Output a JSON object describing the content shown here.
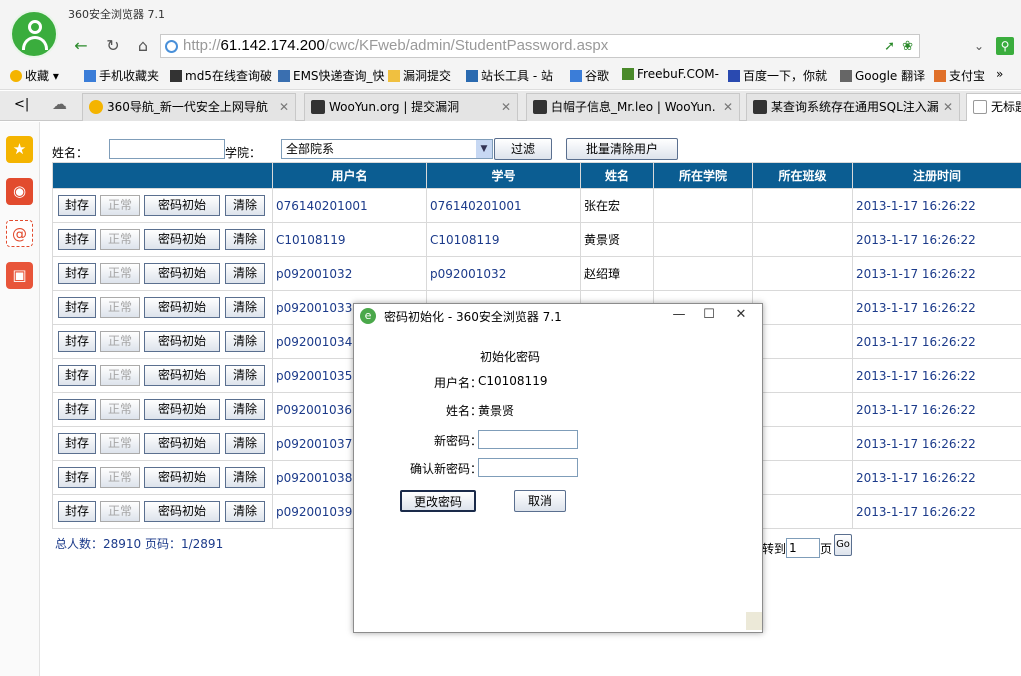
{
  "browser": {
    "app_title": "360安全浏览器 7.1",
    "url_prefix": "http://",
    "url_host": "61.142.174.200",
    "url_path": "/cwc/KFweb/admin/StudentPassword.aspx"
  },
  "bookmarks": [
    "收藏",
    "手机收藏夹",
    "md5在线查询破",
    "EMS快递查询_快",
    "漏洞提交",
    "站长工具 - 站",
    "谷歌",
    "FreebuF.COM-",
    "百度一下，你就",
    "Google 翻译",
    "支付宝"
  ],
  "tabs": [
    "360导航_新一代安全上网导航",
    "WooYun.org | 提交漏洞",
    "白帽子信息_Mr.leo | WooYun.",
    "某查询系统存在通用SQL注入漏",
    "无标题"
  ],
  "filter": {
    "name_label": "姓名：",
    "college_label": "学院：",
    "college_value": "全部院系",
    "filter_button": "过滤",
    "batch_clear_button": "批量清除用户"
  },
  "table": {
    "headers": [
      "",
      "用户名",
      "学号",
      "姓名",
      "所在学院",
      "所在班级",
      "注册时间"
    ],
    "actions": [
      "封存",
      "正常",
      "密码初始",
      "清除"
    ],
    "rows": [
      {
        "username": "076140201001",
        "student_id": "076140201001",
        "name": "张在宏",
        "college": "",
        "class": "",
        "reg_time": "2013-1-17 16:26:22"
      },
      {
        "username": "C10108119",
        "student_id": "C10108119",
        "name": "黄景贤",
        "college": "",
        "class": "",
        "reg_time": "2013-1-17 16:26:22"
      },
      {
        "username": "p092001032",
        "student_id": "p092001032",
        "name": "赵绍璋",
        "college": "",
        "class": "",
        "reg_time": "2013-1-17 16:26:22"
      },
      {
        "username": "p092001033",
        "student_id": "",
        "name": "",
        "college": "",
        "class": "",
        "reg_time": "2013-1-17 16:26:22"
      },
      {
        "username": "p092001034",
        "student_id": "",
        "name": "",
        "college": "",
        "class": "",
        "reg_time": "2013-1-17 16:26:22"
      },
      {
        "username": "p092001035",
        "student_id": "",
        "name": "",
        "college": "",
        "class": "",
        "reg_time": "2013-1-17 16:26:22"
      },
      {
        "username": "P092001036",
        "student_id": "",
        "name": "",
        "college": "",
        "class": "",
        "reg_time": "2013-1-17 16:26:22"
      },
      {
        "username": "p092001037",
        "student_id": "",
        "name": "",
        "college": "",
        "class": "",
        "reg_time": "2013-1-17 16:26:22"
      },
      {
        "username": "p092001038",
        "student_id": "",
        "name": "",
        "college": "",
        "class": "",
        "reg_time": "2013-1-17 16:26:22"
      },
      {
        "username": "p092001039",
        "student_id": "",
        "name": "",
        "college": "",
        "class": "",
        "reg_time": "2013-1-17 16:26:22"
      }
    ]
  },
  "footer": {
    "summary": "总人数：28910 页码：1/2891",
    "jump_label": "转到",
    "jump_value": "1",
    "page_unit": "页",
    "go_label": "Go"
  },
  "dialog": {
    "title": "密码初始化 - 360安全浏览器 7.1",
    "heading": "初始化密码",
    "username_label": "用户名：",
    "username_value": "C10108119",
    "name_label": "姓名：",
    "name_value": "黄景贤",
    "new_pw_label": "新密码：",
    "confirm_pw_label": "确认新密码：",
    "submit_button": "更改密码",
    "cancel_button": "取消"
  },
  "colors": {
    "table_header": "#0b5d92",
    "link_text": "#1b3a8a",
    "logo_green": "#3aad3d"
  }
}
